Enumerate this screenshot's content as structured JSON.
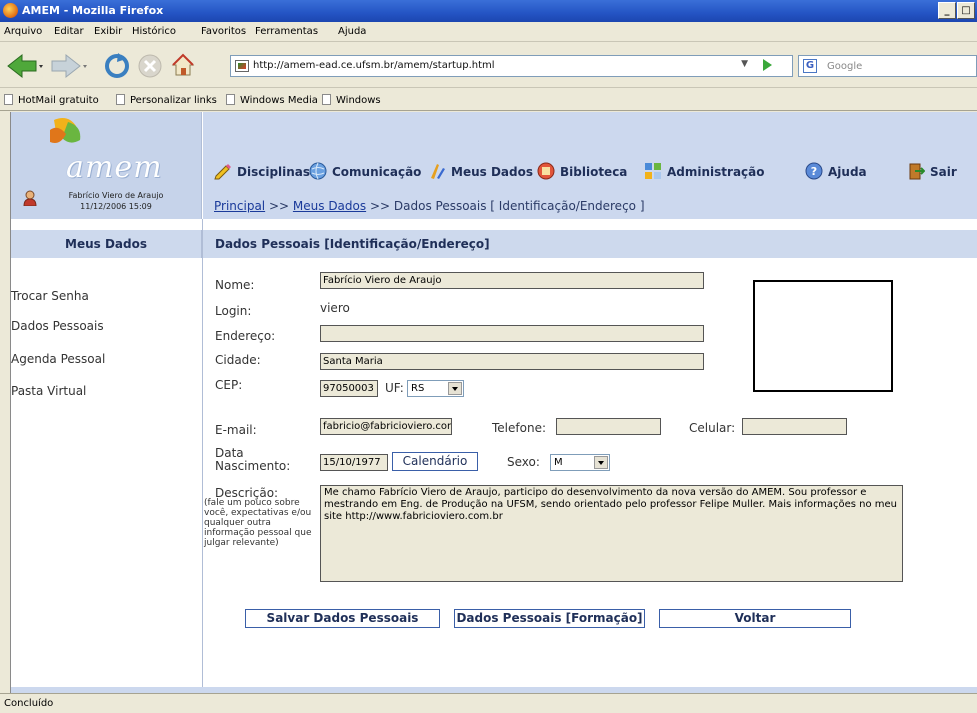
{
  "window": {
    "title": "AMEM - Mozilla Firefox",
    "controls": [
      "_",
      "□"
    ]
  },
  "menubar": {
    "items": [
      "Arquivo",
      "Editar",
      "Exibir",
      "Histórico",
      "Favoritos",
      "Ferramentas",
      "Ajuda"
    ]
  },
  "navigation": {
    "url": "http://amem-ead.ce.ufsm.br/amem/startup.html",
    "search_engine": "Google",
    "search_placeholder": "Google"
  },
  "bookmarks": [
    "HotMail gratuito",
    "Personalizar links",
    "Windows Media",
    "Windows"
  ],
  "app": {
    "logo_text": "amem",
    "user_name": "Fabrício Viero de Araujo",
    "user_datetime": "11/12/2006 15:09",
    "topnav": [
      "Disciplinas",
      "Comunicação",
      "Meus Dados",
      "Biblioteca",
      "Administração",
      "Ajuda",
      "Sair"
    ],
    "breadcrumb": {
      "home": "Principal",
      "sep1": ">>",
      "section": "Meus Dados",
      "sep2": ">>",
      "current": "Dados Pessoais [ Identificação/Endereço ]"
    }
  },
  "sidebar": {
    "title": "Meus Dados",
    "items": [
      "Trocar Senha",
      "Dados Pessoais",
      "Agenda Pessoal",
      "Pasta Virtual"
    ]
  },
  "form": {
    "title": "Dados Pessoais [Identificação/Endereço]",
    "nome_label": "Nome:",
    "nome_value": "Fabrício Viero de Araujo",
    "login_label": "Login:",
    "login_value": "viero",
    "endereco_label": "Endereço:",
    "endereco_value": "",
    "cidade_label": "Cidade:",
    "cidade_value": "Santa Maria",
    "cep_label": "CEP:",
    "cep_value": "97050003",
    "uf_label": "UF:",
    "uf_value": "RS",
    "email_label": "E-mail:",
    "email_value": "fabricio@fabricioviero.com",
    "telefone_label": "Telefone:",
    "telefone_value": "",
    "celular_label": "Celular:",
    "celular_value": "",
    "nascimento_label_1": "Data",
    "nascimento_label_2": "Nascimento:",
    "nascimento_value": "15/10/1977",
    "calendario_label": "Calendário",
    "sexo_label": "Sexo:",
    "sexo_value": "M",
    "descricao_label": "Descrição:",
    "descricao_hint": "(fale um pouco sobre você, expectativas e/ou qualquer outra informação pessoal que julgar relevante)",
    "descricao_value": "Me chamo Fabrício Viero de Araujo, participo do desenvolvimento da nova versão do AMEM. Sou professor e mestrando em Eng. de Produção na UFSM, sendo orientado pelo professor Felipe Muller. Mais informações no meu site http://www.fabricioviero.com.br",
    "buttons": {
      "save": "Salvar Dados Pessoais",
      "formacao": "Dados Pessoais [Formação]",
      "voltar": "Voltar"
    }
  },
  "status": {
    "text": "Concluído"
  }
}
